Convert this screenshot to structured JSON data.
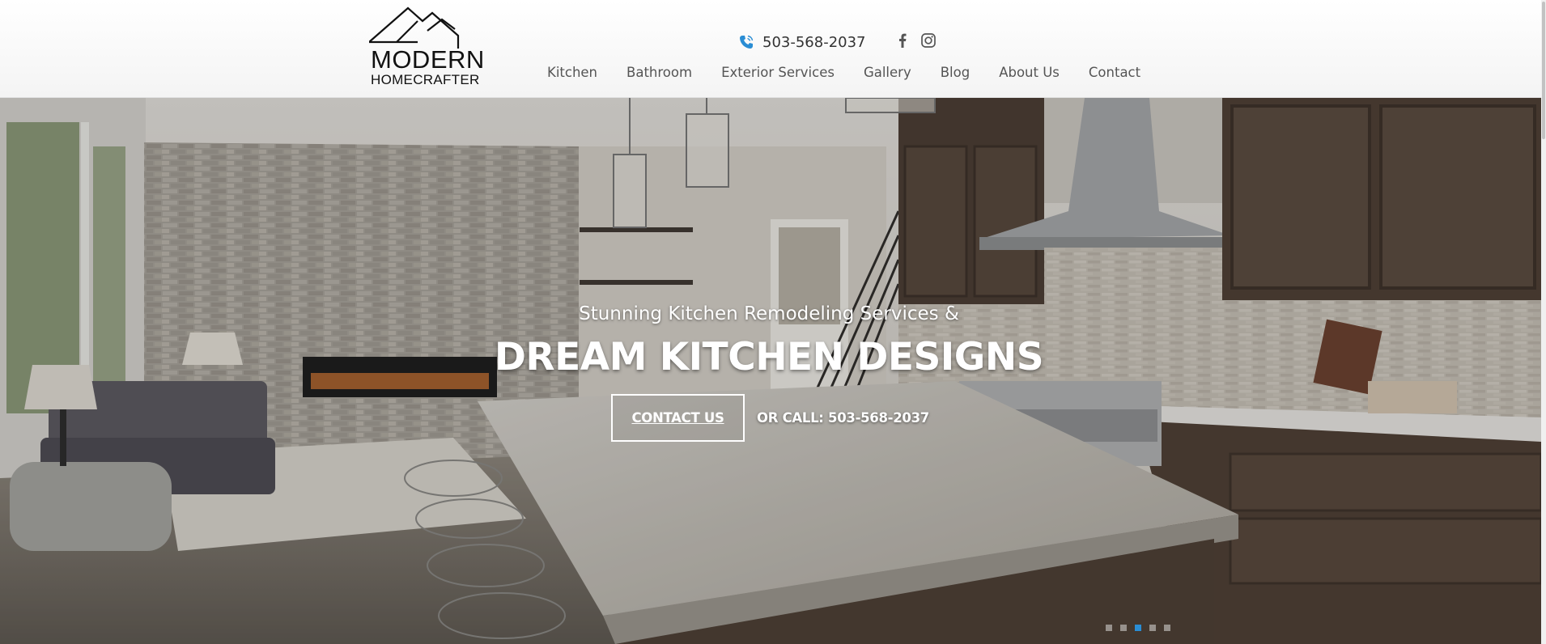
{
  "brand": {
    "line1": "MODERN",
    "line2": "HOMECRAFTER"
  },
  "contact": {
    "phone": "503-568-2037"
  },
  "social": {
    "icons": [
      "facebook-icon",
      "instagram-icon"
    ]
  },
  "nav": {
    "items": [
      {
        "label": "Kitchen"
      },
      {
        "label": "Bathroom"
      },
      {
        "label": "Exterior Services"
      },
      {
        "label": "Gallery"
      },
      {
        "label": "Blog"
      },
      {
        "label": "About Us"
      },
      {
        "label": "Contact"
      }
    ]
  },
  "hero": {
    "subtitle": "Stunning Kitchen Remodeling Services &",
    "title": "DREAM KITCHEN DESIGNS",
    "cta_label": "CONTACT US",
    "call_text": "OR CALL: 503-568-2037",
    "slides_total": 5,
    "active_slide": 3
  },
  "colors": {
    "accent": "#2a8dd4",
    "nav_text": "#555555",
    "hero_text": "#ffffff"
  }
}
